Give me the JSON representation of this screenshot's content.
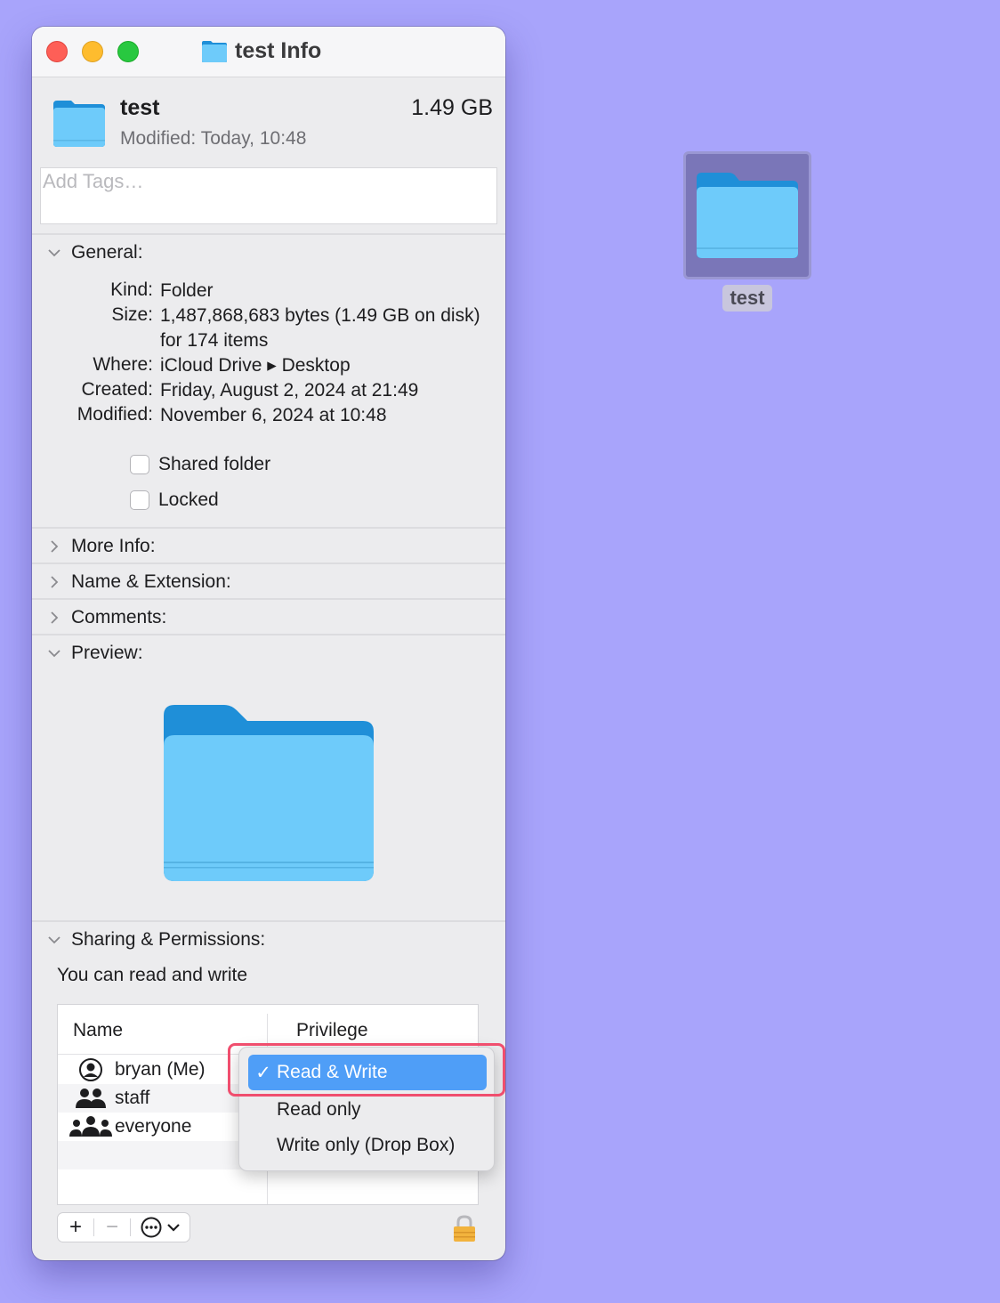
{
  "window": {
    "title": "test Info",
    "file_name": "test",
    "modified_label": "Modified:",
    "modified_value": "Today, 10:48",
    "size": "1.49 GB",
    "tags_placeholder": "Add Tags…"
  },
  "general": {
    "header": "General:",
    "rows": [
      {
        "key": "Kind:",
        "value": "Folder"
      },
      {
        "key": "Size:",
        "value": "1,487,868,683 bytes (1.49 GB on disk) for 174 items"
      },
      {
        "key": "Where:",
        "value": "iCloud Drive ▸ Desktop"
      },
      {
        "key": "Created:",
        "value": "Friday, August 2, 2024 at 21:49"
      },
      {
        "key": "Modified:",
        "value": "November 6, 2024 at 10:48"
      }
    ],
    "shared_folder": "Shared folder",
    "locked": "Locked"
  },
  "sections": {
    "more_info": "More Info:",
    "name_extension": "Name & Extension:",
    "comments": "Comments:",
    "preview": "Preview:",
    "sharing": "Sharing & Permissions:"
  },
  "permissions": {
    "summary": "You can read and write",
    "col_name": "Name",
    "col_privilege": "Privilege",
    "users": [
      {
        "name": "bryan (Me)",
        "icon": "person-icon"
      },
      {
        "name": "staff",
        "icon": "group-icon"
      },
      {
        "name": "everyone",
        "icon": "everyone-icon"
      }
    ],
    "menu": {
      "selected": "Read & Write",
      "options": [
        "Read only",
        "Write only (Drop Box)"
      ],
      "check": "✓"
    }
  },
  "toolbar": {
    "add": "+",
    "remove": "−",
    "more": "⋯"
  },
  "desktop": {
    "folder_label": "test"
  },
  "colors": {
    "desktop_bg": "#a8a4fb",
    "folder_blue": "#6ecbfa",
    "menu_selected": "#4f9ef7",
    "highlight": "#f04e6e"
  }
}
